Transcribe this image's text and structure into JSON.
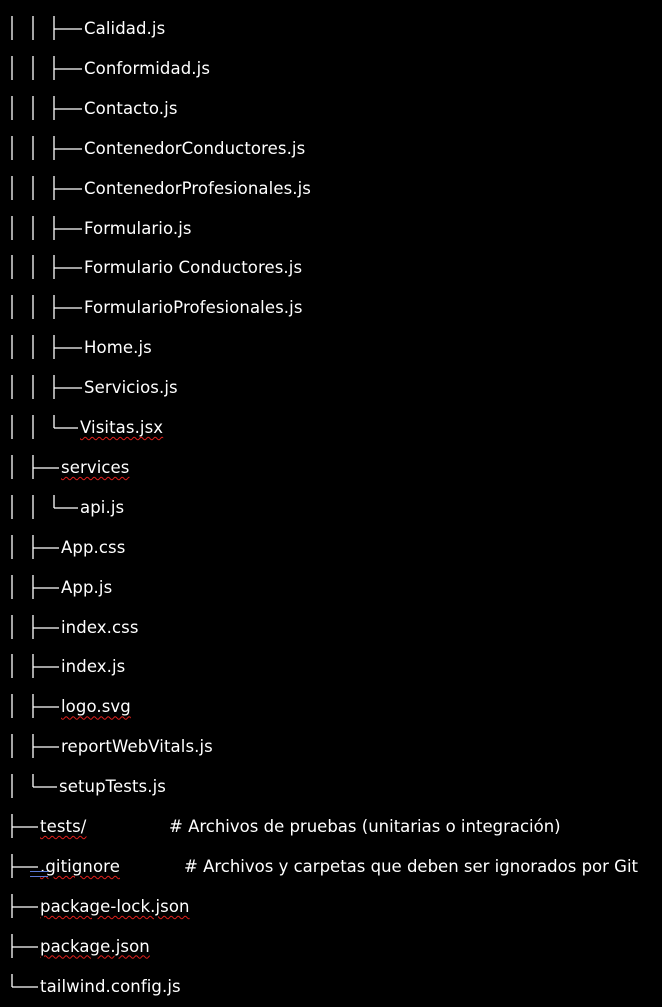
{
  "tree": {
    "lines": [
      {
        "name": "Calidad.js",
        "depth": 3,
        "last": false,
        "spell": false
      },
      {
        "name": "Conformidad.js",
        "depth": 3,
        "last": false,
        "spell": false
      },
      {
        "name": "Contacto.js",
        "depth": 3,
        "last": false,
        "spell": false
      },
      {
        "name": "ContenedorConductores.js",
        "depth": 3,
        "last": false,
        "spell": false
      },
      {
        "name": "ContenedorProfesionales.js",
        "depth": 3,
        "last": false,
        "spell": false
      },
      {
        "name": "Formulario.js",
        "depth": 3,
        "last": false,
        "spell": false
      },
      {
        "name": "Formulario Conductores.js",
        "depth": 3,
        "last": false,
        "spell": false
      },
      {
        "name": "FormularioProfesionales.js",
        "depth": 3,
        "last": false,
        "spell": false
      },
      {
        "name": "Home.js",
        "depth": 3,
        "last": false,
        "spell": false
      },
      {
        "name": "Servicios.js",
        "depth": 3,
        "last": false,
        "spell": false
      },
      {
        "name": "Visitas.jsx",
        "depth": 3,
        "last": true,
        "spell": true
      },
      {
        "name": "services",
        "depth": 2,
        "last": false,
        "spell": true
      },
      {
        "name": "api.js",
        "depth": 3,
        "last": true,
        "spell": false
      },
      {
        "name": "App.css",
        "depth": 2,
        "last": false,
        "spell": false
      },
      {
        "name": "App.js",
        "depth": 2,
        "last": false,
        "spell": false
      },
      {
        "name": "index.css",
        "depth": 2,
        "last": false,
        "spell": false
      },
      {
        "name": "index.js",
        "depth": 2,
        "last": false,
        "spell": false
      },
      {
        "name": "logo.svg",
        "depth": 2,
        "last": false,
        "spell": true
      },
      {
        "name": "reportWebVitals.js",
        "depth": 2,
        "last": false,
        "spell": false
      },
      {
        "name": "setupTests.js",
        "depth": 2,
        "last": true,
        "spell": false
      },
      {
        "name": "tests/",
        "depth": 1,
        "last": false,
        "spell": true,
        "comment": "# Archivos de pruebas (unitarias o integración)"
      },
      {
        "name": ".gitignore",
        "depth": 1,
        "last": false,
        "spell": true,
        "comment": "# Archivos y carpetas que deben ser ignorados por Git"
      },
      {
        "name": "package-lock.json",
        "depth": 1,
        "last": false,
        "spell": true
      },
      {
        "name": "package.json",
        "depth": 1,
        "last": false,
        "spell": true
      },
      {
        "name": "tailwind.config.js",
        "depth": 1,
        "last": true,
        "spell": false
      }
    ]
  },
  "colors": {
    "background": "#000000",
    "text": "#ffffff",
    "spellcheck_underline": "#e0201c",
    "autocorrect_mark": "#5a7ad8"
  }
}
